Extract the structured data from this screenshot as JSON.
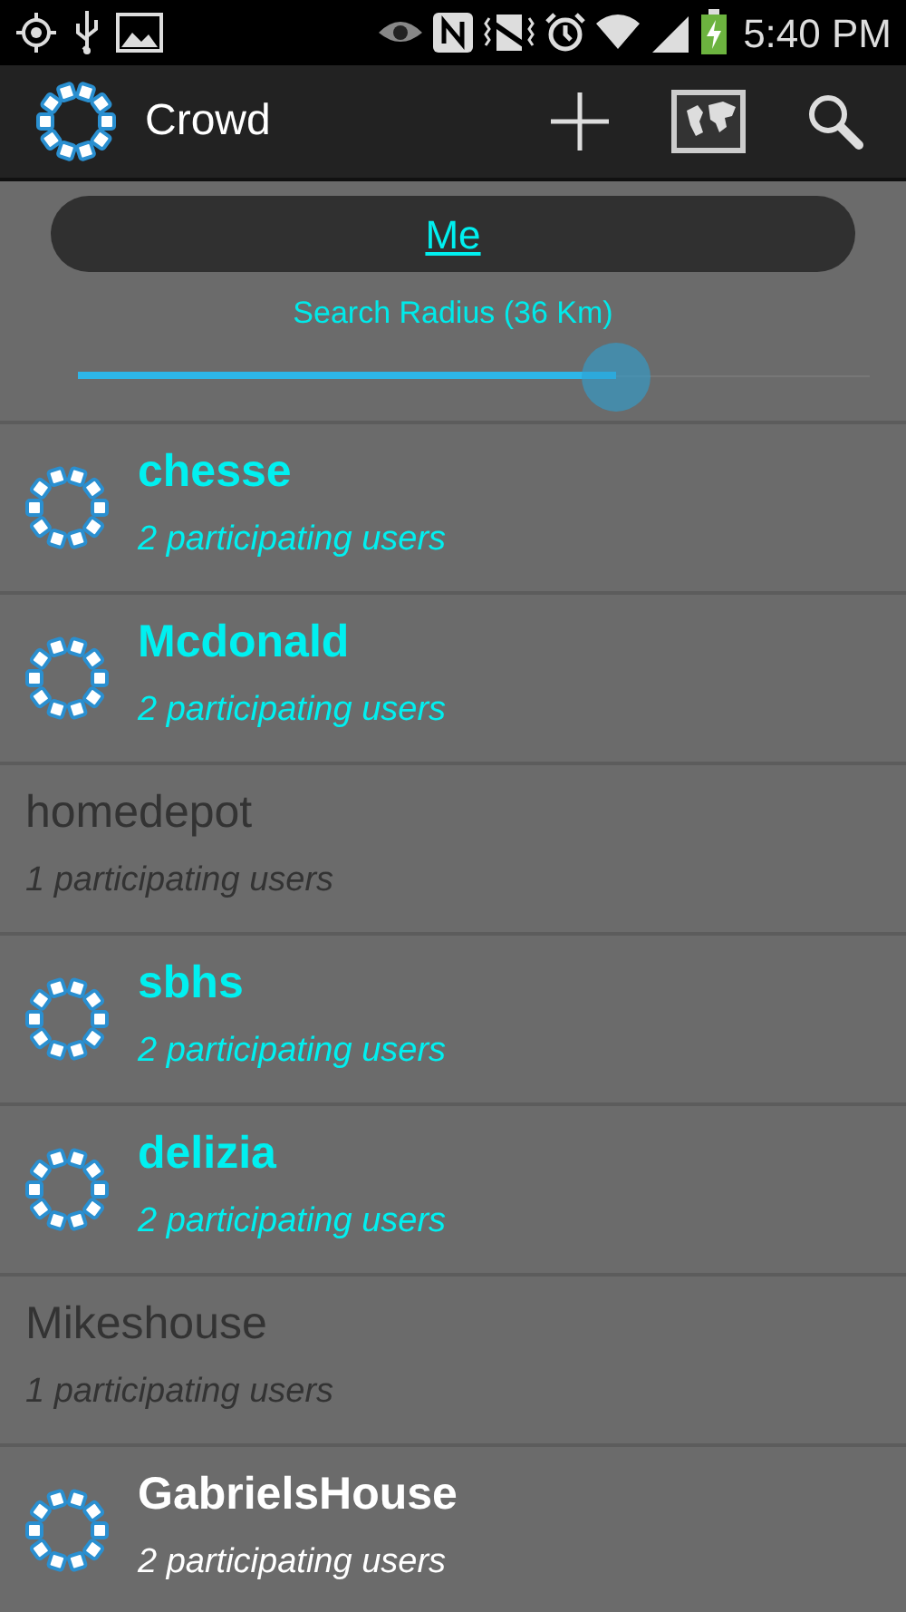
{
  "status_bar": {
    "time": "5:40 PM"
  },
  "action_bar": {
    "title": "Crowd"
  },
  "me_button": {
    "label": "Me"
  },
  "radius": {
    "label": "Search Radius (36 Km)",
    "level": 0.68
  },
  "crowds": [
    {
      "kind": "crowd",
      "name": "chesse",
      "subtitle": "2 participating users",
      "highlighted": true
    },
    {
      "kind": "crowd",
      "name": "Mcdonald",
      "subtitle": "2 participating users",
      "highlighted": true
    },
    {
      "kind": "place",
      "name": "homedepot",
      "subtitle": "1 participating users",
      "highlighted": false
    },
    {
      "kind": "crowd",
      "name": "sbhs",
      "subtitle": "2 participating users",
      "highlighted": true
    },
    {
      "kind": "crowd",
      "name": "delizia",
      "subtitle": "2 participating users",
      "highlighted": true
    },
    {
      "kind": "place",
      "name": "Mikeshouse",
      "subtitle": "1 participating users",
      "highlighted": false
    },
    {
      "kind": "crowd",
      "name": "GabrielsHouse",
      "subtitle": "2 participating users",
      "highlighted": false
    }
  ]
}
